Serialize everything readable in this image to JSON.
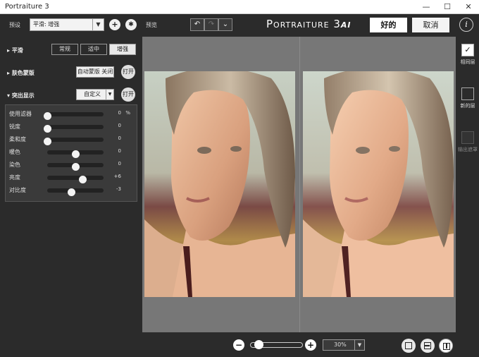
{
  "window": {
    "title": "Portraiture 3",
    "minimize": "—",
    "maximize": "☐",
    "close": "✕"
  },
  "toolbar": {
    "preset_label": "预设",
    "preset_value": "平滑: 增强",
    "preview_label": "预览",
    "brand_main": "Portraiture 3",
    "brand_ai": "ai",
    "ok_label": "好的",
    "cancel_label": "取消",
    "help_label": "i"
  },
  "smoothing": {
    "title": "平滑",
    "options": [
      "常规",
      "适中",
      "增强"
    ],
    "selected": "增强"
  },
  "skin_mask": {
    "title": "肤色蒙版",
    "auto_button": "自动蒙版 关闭",
    "open_button": "打开"
  },
  "enhance": {
    "title": "突出显示",
    "preset_value": "自定义",
    "open_button": "打开",
    "sliders": [
      {
        "label": "使用滤器",
        "value": "0",
        "fraction": 0.0,
        "unit": "%"
      },
      {
        "label": "锐度",
        "value": "0",
        "fraction": 0.0,
        "unit": ""
      },
      {
        "label": "柔和度",
        "value": "0",
        "fraction": 0.0,
        "unit": ""
      },
      {
        "label": "暖色",
        "value": "0",
        "fraction": 0.5,
        "unit": ""
      },
      {
        "label": "染色",
        "value": "0",
        "fraction": 0.5,
        "unit": ""
      },
      {
        "label": "亮度",
        "value": "+6",
        "fraction": 0.63,
        "unit": ""
      },
      {
        "label": "对比度",
        "value": "-3",
        "fraction": 0.43,
        "unit": ""
      }
    ]
  },
  "output": {
    "same_layer_label": "相同层",
    "new_layer_label": "新的层",
    "output_mask_label": "输出遮罩"
  },
  "zoom": {
    "minus": "−",
    "plus": "+",
    "value": "30%",
    "slider_fraction": 0.1
  },
  "colors": {
    "background": "#2b2b2b",
    "preview_bg": "#777777",
    "accent": "#ffffff"
  }
}
